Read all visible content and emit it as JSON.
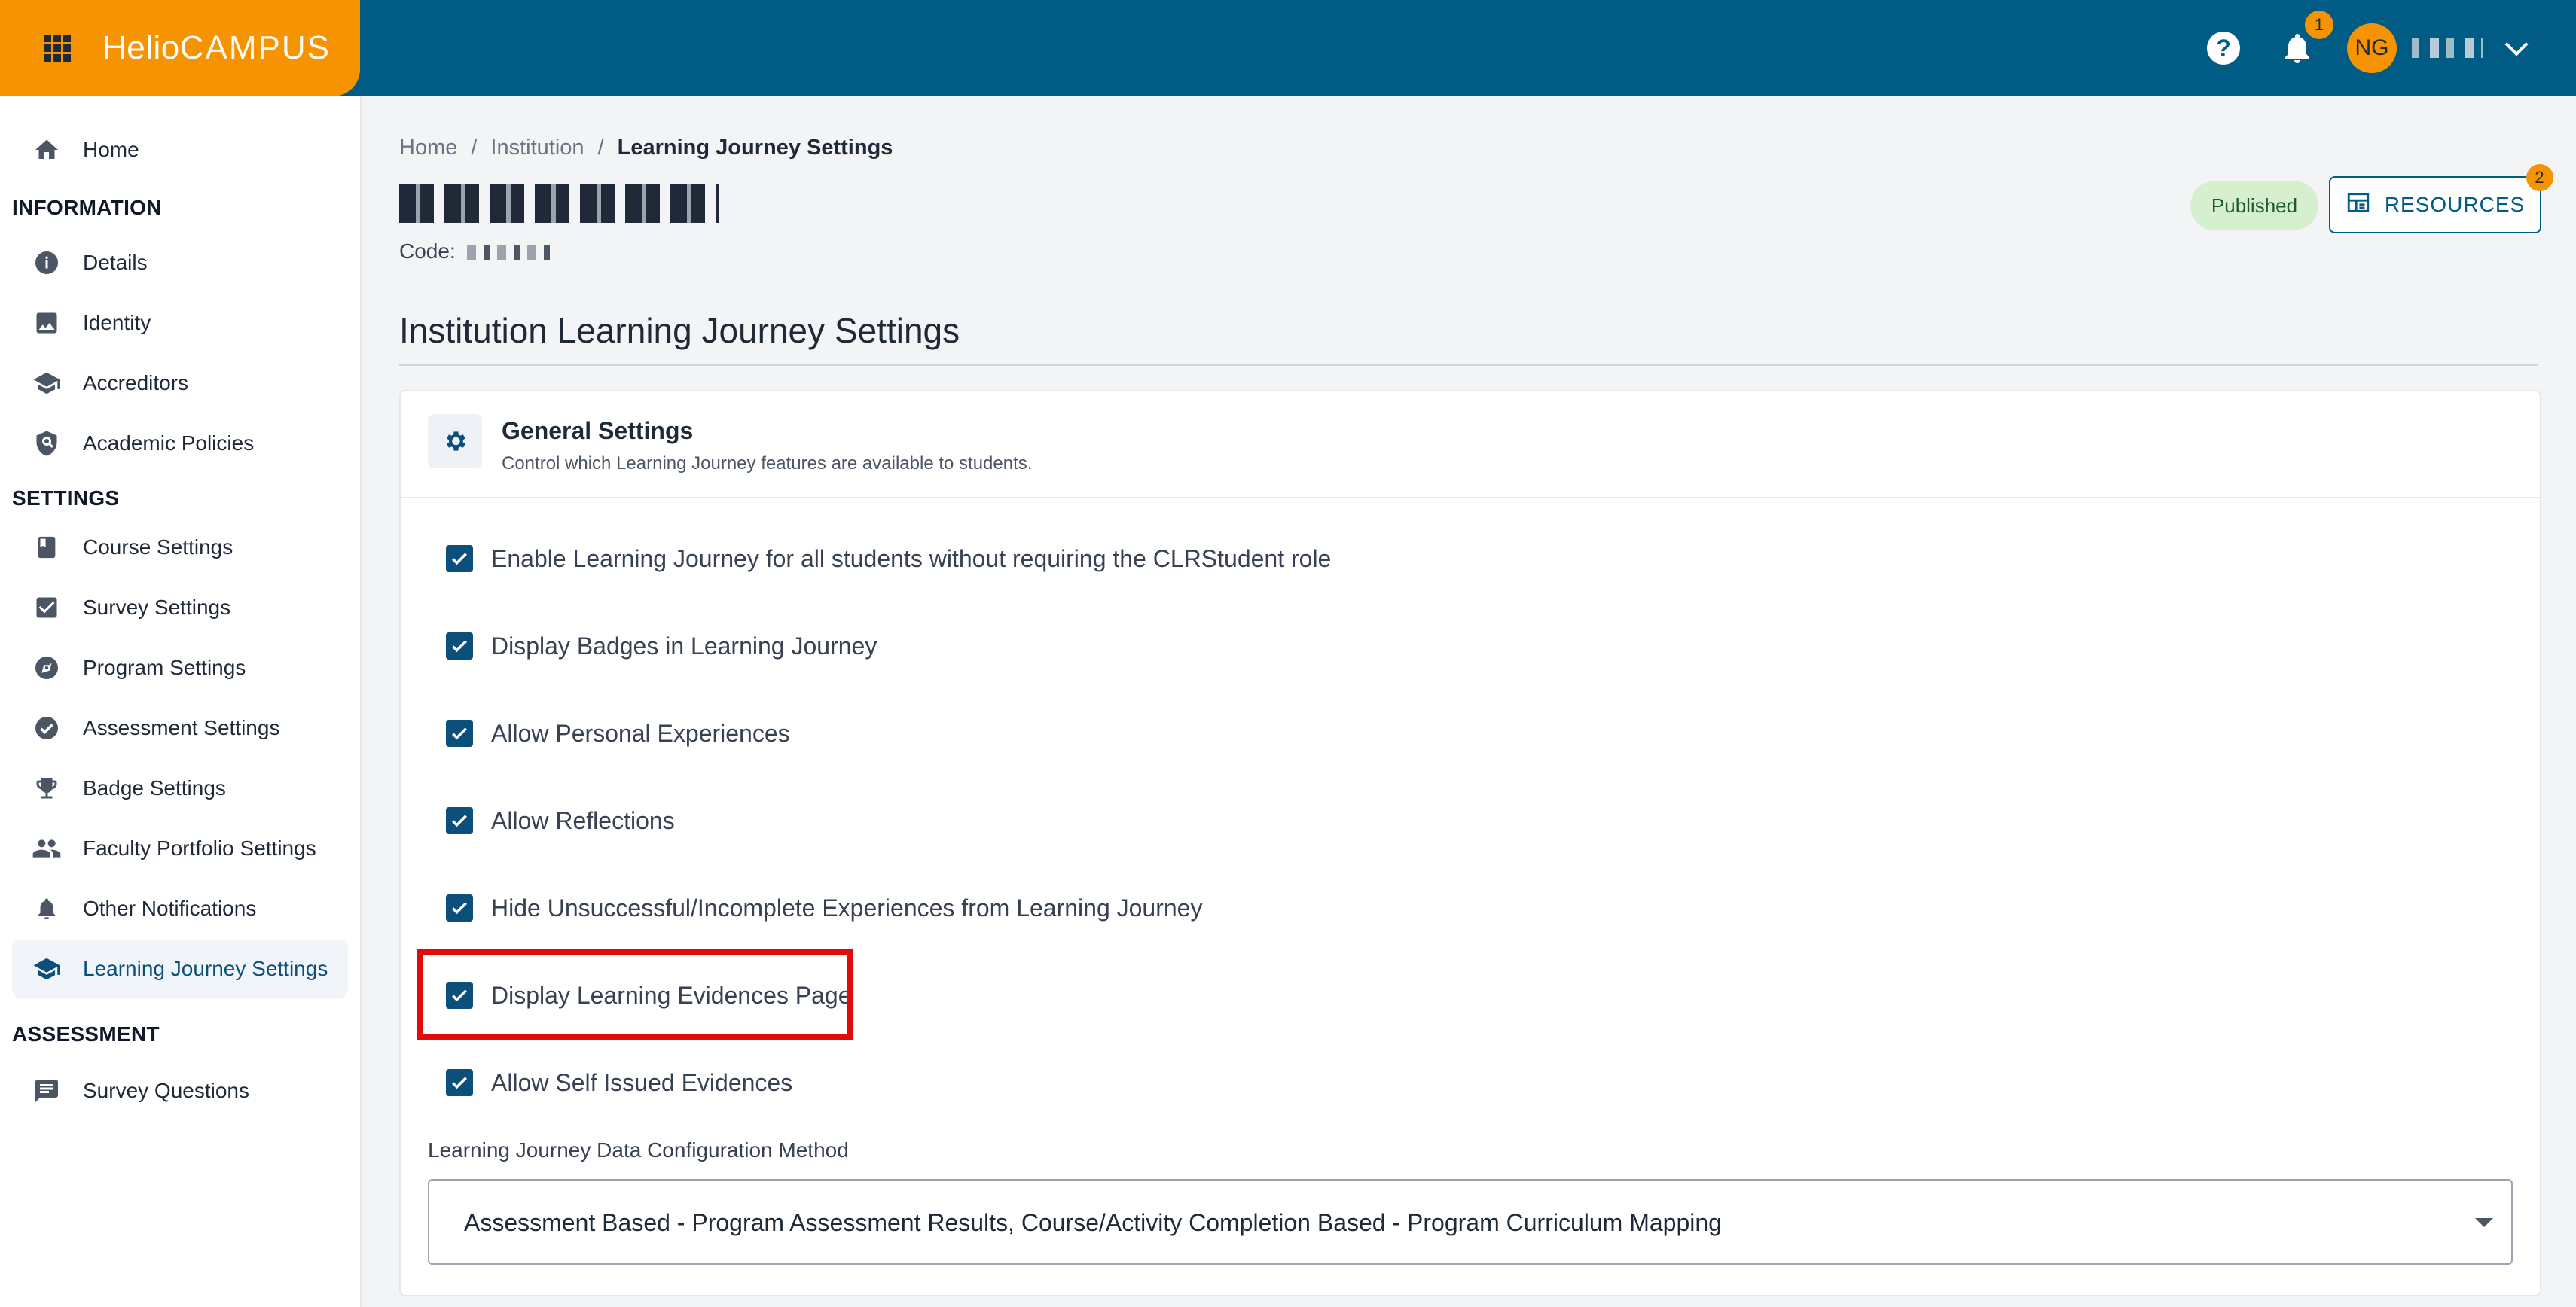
{
  "brand": {
    "logo_primary": "Helio",
    "logo_secondary": "CAMPUS"
  },
  "header": {
    "notifications_count": "1",
    "user_initials": "NG"
  },
  "sidebar": {
    "items_top": [
      {
        "label": "Home",
        "icon": "home-icon"
      }
    ],
    "sections": [
      {
        "title": "INFORMATION",
        "items": [
          {
            "label": "Details",
            "icon": "info-icon"
          },
          {
            "label": "Identity",
            "icon": "image-icon"
          },
          {
            "label": "Accreditors",
            "icon": "graduation-cap-icon"
          },
          {
            "label": "Academic Policies",
            "icon": "policy-shield-icon"
          }
        ]
      },
      {
        "title": "SETTINGS",
        "items": [
          {
            "label": "Course Settings",
            "icon": "book-icon"
          },
          {
            "label": "Survey Settings",
            "icon": "checkbox-icon"
          },
          {
            "label": "Program Settings",
            "icon": "compass-icon"
          },
          {
            "label": "Assessment Settings",
            "icon": "check-circle-icon"
          },
          {
            "label": "Badge Settings",
            "icon": "trophy-icon"
          },
          {
            "label": "Faculty Portfolio Settings",
            "icon": "people-icon"
          },
          {
            "label": "Other Notifications",
            "icon": "bell-icon"
          },
          {
            "label": "Learning Journey Settings",
            "icon": "graduation-cap-icon",
            "active": true
          }
        ]
      },
      {
        "title": "ASSESSMENT",
        "items": [
          {
            "label": "Survey Questions",
            "icon": "chat-icon"
          }
        ]
      }
    ]
  },
  "breadcrumb": [
    "Home",
    "Institution",
    "Learning Journey Settings"
  ],
  "code_label": "Code:",
  "status_badge": "Published",
  "resources": {
    "label": "RESOURCES",
    "count": "2"
  },
  "page_heading": "Institution Learning Journey Settings",
  "general_settings": {
    "title": "General Settings",
    "subtitle": "Control which Learning Journey features are available to students.",
    "options": [
      {
        "label": "Enable Learning Journey for all students without requiring the CLRStudent role",
        "checked": true
      },
      {
        "label": "Display Badges in Learning Journey",
        "checked": true
      },
      {
        "label": "Allow Personal Experiences",
        "checked": true
      },
      {
        "label": "Allow Reflections",
        "checked": true
      },
      {
        "label": "Hide Unsuccessful/Incomplete Experiences from Learning Journey",
        "checked": true
      },
      {
        "label": "Display Learning Evidences Page",
        "checked": true,
        "highlighted": true
      },
      {
        "label": "Allow Self Issued Evidences",
        "checked": true
      }
    ],
    "data_config": {
      "label": "Learning Journey Data Configuration Method",
      "value": "Assessment Based - Program Assessment Results, Course/Activity Completion Based - Program Curriculum Mapping"
    }
  },
  "colors": {
    "brand_orange": "#f59300",
    "header_blue": "#005c85",
    "checkbox_blue": "#0b4f7a",
    "highlight_red": "#e10b0b",
    "published_bg": "#d6f0cf"
  }
}
